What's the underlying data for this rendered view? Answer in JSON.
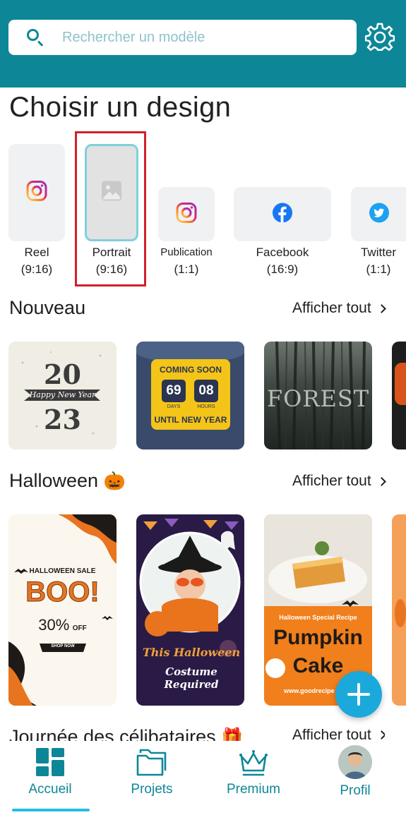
{
  "search": {
    "placeholder": "Rechercher un modèle"
  },
  "page_title": "Choisir un design",
  "formats": [
    {
      "label": "Reel",
      "ratio": "(9:16)",
      "icon": "instagram-icon"
    },
    {
      "label": "Portrait",
      "ratio": "(9:16)",
      "icon": "image-placeholder-icon",
      "selected": true
    },
    {
      "label": "Publication",
      "ratio": "(1:1)",
      "icon": "instagram-icon"
    },
    {
      "label": "Facebook",
      "ratio": "(16:9)",
      "icon": "facebook-icon"
    },
    {
      "label": "Twitter",
      "ratio": "(1:1)",
      "icon": "twitter-icon"
    }
  ],
  "sections": {
    "nouveau": {
      "title": "Nouveau",
      "see_all": "Afficher tout",
      "templates": [
        {
          "name": "new-year-2023",
          "line1": "20",
          "line2": "Happy New Year",
          "line3": "23"
        },
        {
          "name": "countdown",
          "heading": "COMING SOON",
          "days": "69",
          "days_label": "DAYS",
          "hours": "08",
          "hours_label": "HOURS",
          "footer": "UNTIL NEW YEAR"
        },
        {
          "name": "forest",
          "text": "FOREST"
        },
        {
          "name": "food-partial"
        }
      ]
    },
    "halloween": {
      "title": "Halloween",
      "emoji": "🎃",
      "see_all": "Afficher tout",
      "templates": [
        {
          "name": "halloween-sale",
          "line1": "HALLOWEEN SALE",
          "line2": "BOO!",
          "line3": "30%",
          "line3_suffix": "OFF",
          "button": "SHOP NOW"
        },
        {
          "name": "costume",
          "line1": "This Halloween",
          "line2": "Costume Required"
        },
        {
          "name": "pumpkin-cake",
          "line1": "Halloween Special Recipe",
          "line2": "Pumpkin",
          "line3": "Cake",
          "line4": "www.goodrecipe"
        }
      ]
    },
    "singles": {
      "title": "Journée des célibataires",
      "emoji": "🎁",
      "see_all": "Afficher tout"
    }
  },
  "nav": [
    {
      "label": "Accueil",
      "icon": "home-grid-icon",
      "active": true
    },
    {
      "label": "Projets",
      "icon": "folder-icon"
    },
    {
      "label": "Premium",
      "icon": "crown-icon"
    },
    {
      "label": "Profil",
      "icon": "avatar"
    }
  ],
  "colors": {
    "primary": "#0d8797",
    "accent": "#1ba9dc",
    "highlight": "#d21f2a"
  }
}
